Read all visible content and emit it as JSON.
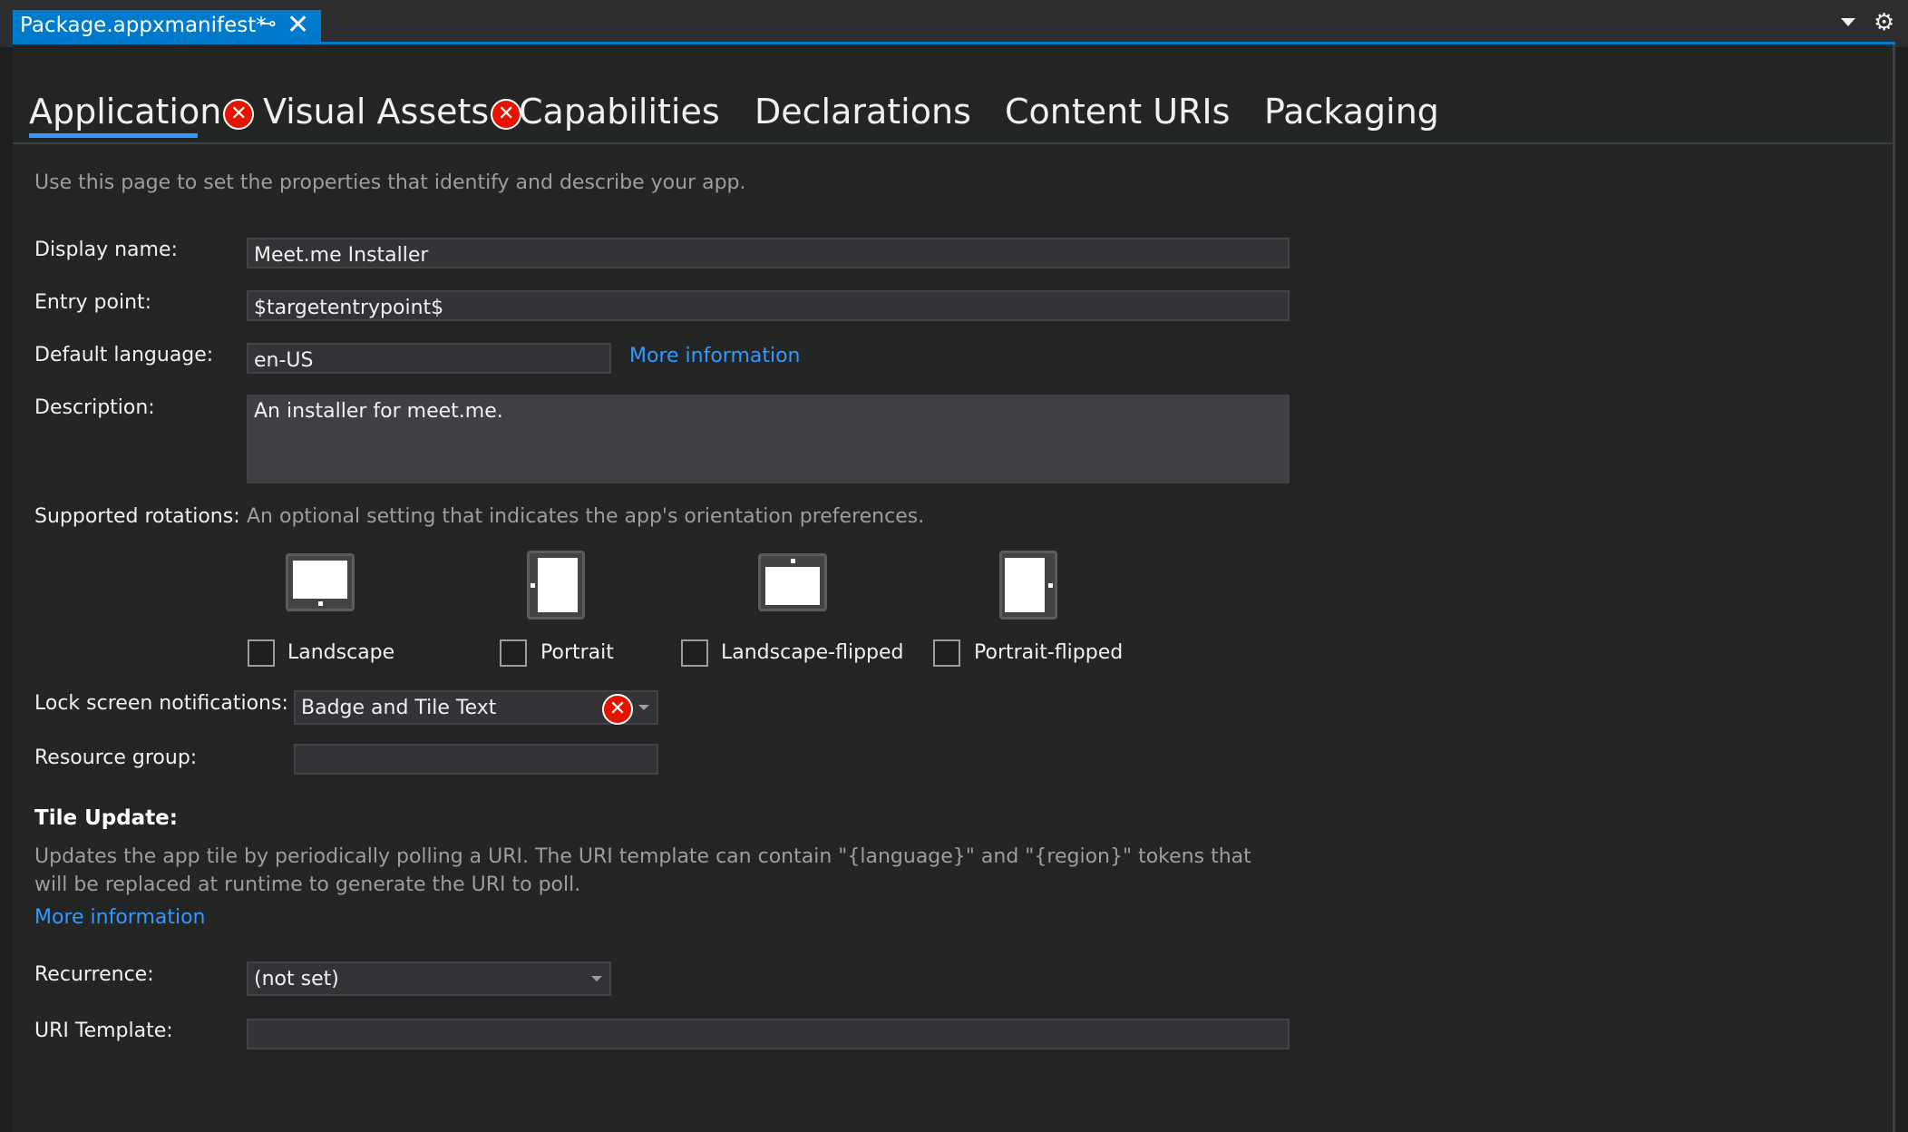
{
  "document_tab": {
    "title": "Package.appxmanifest*",
    "pin_icon": "pin-icon",
    "close_icon": "close-icon"
  },
  "window_controls": {
    "dropdown_icon": "chevron-down-icon",
    "settings_icon": "gear-icon"
  },
  "tabs": [
    {
      "label": "Application",
      "has_error": true,
      "active": true
    },
    {
      "label": "Visual Assets",
      "has_error": true,
      "active": false
    },
    {
      "label": "Capabilities",
      "has_error": false,
      "active": false
    },
    {
      "label": "Declarations",
      "has_error": false,
      "active": false
    },
    {
      "label": "Content URIs",
      "has_error": false,
      "active": false
    },
    {
      "label": "Packaging",
      "has_error": false,
      "active": false
    }
  ],
  "intro": "Use this page to set the properties that identify and describe your app.",
  "form": {
    "display_name": {
      "label": "Display name:",
      "value": "Meet.me Installer"
    },
    "entry_point": {
      "label": "Entry point:",
      "value": "$targetentrypoint$"
    },
    "default_language": {
      "label": "Default language:",
      "value": "en-US",
      "link": "More information"
    },
    "description": {
      "label": "Description:",
      "value": "An installer for meet.me."
    },
    "supported_rotations": {
      "label": "Supported rotations:",
      "hint": "An optional setting that indicates the app's orientation preferences.",
      "options": [
        {
          "label": "Landscape",
          "checked": false
        },
        {
          "label": "Portrait",
          "checked": false
        },
        {
          "label": "Landscape-flipped",
          "checked": false
        },
        {
          "label": "Portrait-flipped",
          "checked": false
        }
      ]
    },
    "lock_screen": {
      "label": "Lock screen notifications:",
      "value": "Badge and Tile Text",
      "has_error": true
    },
    "resource_group": {
      "label": "Resource group:",
      "value": ""
    }
  },
  "tile_update": {
    "heading": "Tile Update:",
    "description": "Updates the app tile by periodically polling a URI. The URI template can contain \"{language}\" and \"{region}\" tokens that will be replaced at runtime to generate the URI to poll.",
    "link": "More information",
    "recurrence": {
      "label": "Recurrence:",
      "value": "(not set)"
    },
    "uri_template": {
      "label": "URI Template:",
      "value": ""
    }
  },
  "colors": {
    "accent": "#007acc",
    "link": "#3399ff",
    "error": "#e51400",
    "background": "#232525"
  }
}
